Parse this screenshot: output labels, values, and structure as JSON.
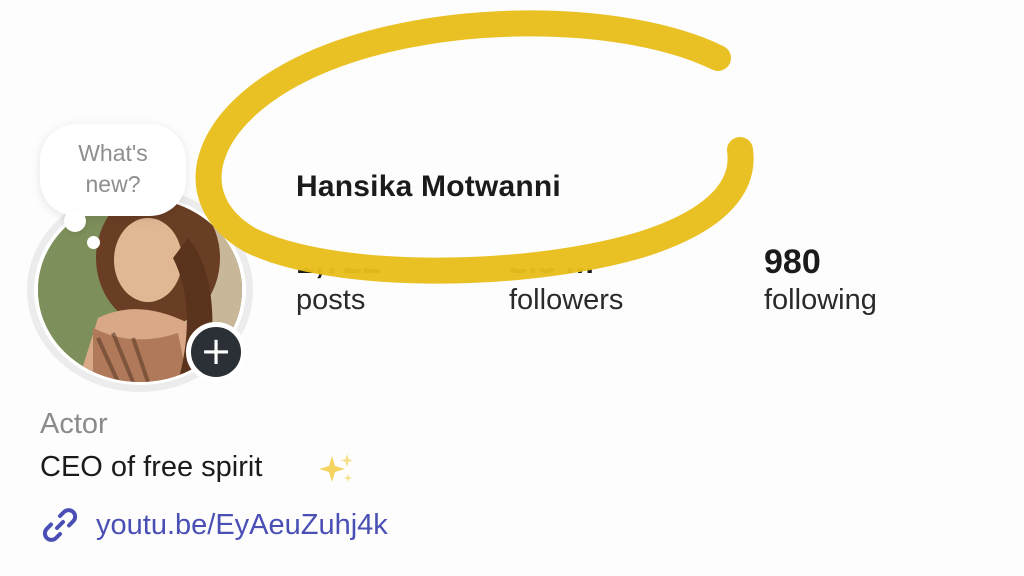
{
  "note": {
    "line1": "What's",
    "line2": "new?"
  },
  "profile": {
    "name": "Hansika Motwanni"
  },
  "stats": {
    "posts": {
      "value": "1,722",
      "label": "posts"
    },
    "followers": {
      "value": "2.5 M",
      "label": "followers"
    },
    "following": {
      "value": "980",
      "label": "following"
    }
  },
  "bio": {
    "category": "Actor",
    "text": "CEO of free spirit",
    "link": "youtu.be/EyAeuZuhj4k"
  },
  "colors": {
    "highlight": "#e9be1c",
    "link": "#4a4fb5",
    "add_button": "#2b2f36"
  },
  "icons": {
    "add": "plus-icon",
    "link": "link-icon",
    "sparkles": "sparkles-icon"
  }
}
